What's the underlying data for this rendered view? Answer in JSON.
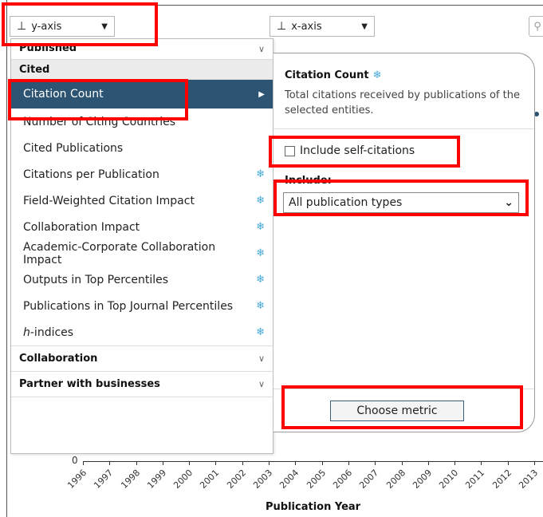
{
  "axes": {
    "y_label": "y-axis",
    "x_label": "x-axis"
  },
  "menu": {
    "categories": {
      "published": "Published",
      "cited": "Cited",
      "collaboration": "Collaboration",
      "partner": "Partner with businesses"
    },
    "cited_items": [
      {
        "label": "Citation Count",
        "selected": true,
        "snowball": false
      },
      {
        "label": "Number of Citing Countries",
        "snowball": false
      },
      {
        "label": "Cited Publications",
        "snowball": false
      },
      {
        "label": "Citations per Publication",
        "snowball": true
      },
      {
        "label": "Field-Weighted Citation Impact",
        "snowball": true
      },
      {
        "label": "Collaboration Impact",
        "snowball": true
      },
      {
        "label": "Academic-Corporate Collaboration Impact",
        "snowball": true
      },
      {
        "label": "Outputs in Top Percentiles",
        "snowball": true
      },
      {
        "label": "Publications in Top Journal Percentiles",
        "snowball": true
      },
      {
        "label_italic": "h",
        "label_rest": "-indices",
        "snowball": true
      }
    ]
  },
  "panel": {
    "title": "Citation Count",
    "description": "Total citations received by publications of the selected entities.",
    "checkbox_label": "Include self-citations",
    "include_label": "Include:",
    "include_value": "All publication types",
    "choose_button": "Choose metric"
  },
  "chart": {
    "y_zero": "0",
    "years": [
      "1996",
      "1997",
      "1998",
      "1999",
      "2000",
      "2001",
      "2002",
      "2003",
      "2004",
      "2005",
      "2006",
      "2007",
      "2008",
      "2009",
      "2010",
      "2011",
      "2012",
      "2013"
    ],
    "x_title": "Publication Year"
  },
  "colors": {
    "selected_bg": "#2d5573",
    "snowball": "#45a8d8",
    "highlight": "#ff0000"
  }
}
